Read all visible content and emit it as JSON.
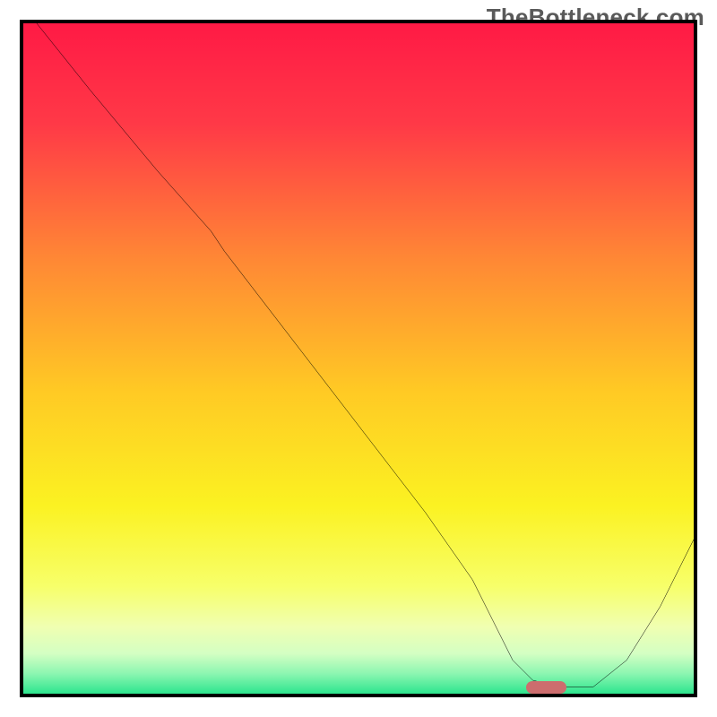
{
  "watermark": "TheBottleneck.com",
  "marker_color": "#cd6d6e",
  "chart_data": {
    "type": "line",
    "title": "",
    "xlabel": "",
    "ylabel": "",
    "xlim": [
      0,
      100
    ],
    "ylim": [
      0,
      100
    ],
    "grid": false,
    "legend": false,
    "series": [
      {
        "name": "curve",
        "x": [
          2,
          10,
          20,
          28,
          30,
          40,
          50,
          60,
          67,
          70,
          73,
          76,
          80,
          85,
          90,
          95,
          100
        ],
        "y": [
          100,
          90,
          78,
          69,
          66,
          53,
          40,
          27,
          17,
          11,
          5,
          2,
          1,
          1,
          5,
          13,
          23
        ]
      }
    ],
    "marker": {
      "x": 78,
      "y": 1,
      "width": 6,
      "color": "#cd6d6e"
    },
    "gradient_stops": [
      {
        "offset": 0,
        "color": "#ff1a45"
      },
      {
        "offset": 15,
        "color": "#ff3947"
      },
      {
        "offset": 35,
        "color": "#ff8735"
      },
      {
        "offset": 55,
        "color": "#ffca24"
      },
      {
        "offset": 72,
        "color": "#fbf222"
      },
      {
        "offset": 84,
        "color": "#f7ff6a"
      },
      {
        "offset": 90,
        "color": "#f0ffb1"
      },
      {
        "offset": 94,
        "color": "#d4ffc3"
      },
      {
        "offset": 97,
        "color": "#8cf6b1"
      },
      {
        "offset": 100,
        "color": "#2de58e"
      }
    ]
  }
}
